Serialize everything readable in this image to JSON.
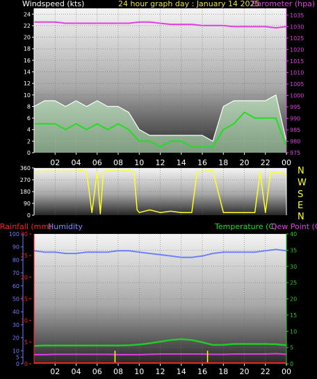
{
  "header": {
    "windspeed_title": "Windspeed (kts)",
    "graph_day": "24 hour graph day :  January 14 2025",
    "barometer_title": "Barometer (hpa)"
  },
  "mid_header": {
    "rainfall_title": "Rainfall (mm)",
    "humidity_title": "Humidity",
    "temperature_title": "Temperature (C)",
    "dewpoint_title": "Dew Point (C)"
  },
  "direction_labels": [
    "N",
    "W",
    "S",
    "E",
    "N"
  ],
  "colors": {
    "barometer": "#e040e0",
    "windspeed_gust": "#ffffff",
    "windspeed_avg": "#22dd22",
    "windspeed_fill": "#ccffcc",
    "direction": "#ffff22",
    "humidity": "#6f7fff",
    "temperature": "#22cc22",
    "dewpoint": "#e040e0",
    "rainfall": "#ff2020",
    "rain_event": "#ffff22"
  },
  "chart_data": [
    {
      "type": "line",
      "title": "Windspeed (kts) / Barometer (hpa)",
      "x_ticks": [
        "02",
        "04",
        "06",
        "08",
        "10",
        "12",
        "14",
        "16",
        "18",
        "20",
        "22",
        "00"
      ],
      "x_hours": [
        0,
        24
      ],
      "ylim_left": [
        0,
        25
      ],
      "y_ticks_left": [
        0,
        2,
        4,
        6,
        8,
        10,
        12,
        14,
        16,
        18,
        20,
        22,
        24
      ],
      "ylim_right": [
        975,
        1038
      ],
      "y_ticks_right": [
        975,
        980,
        985,
        990,
        995,
        1000,
        1005,
        1010,
        1015,
        1020,
        1025,
        1030,
        1035
      ],
      "series": [
        {
          "name": "Barometer",
          "axis": "right",
          "x": [
            0,
            1,
            2,
            3,
            4,
            5,
            6,
            7,
            8,
            9,
            10,
            11,
            12,
            13,
            14,
            15,
            16,
            17,
            18,
            19,
            20,
            21,
            22,
            23,
            24
          ],
          "values": [
            1032,
            1032,
            1032,
            1031.5,
            1031.5,
            1031.5,
            1031.5,
            1031.5,
            1031.5,
            1031.5,
            1032,
            1032,
            1031.5,
            1031,
            1031,
            1031,
            1030.5,
            1030.5,
            1030.5,
            1030,
            1030,
            1030,
            1030,
            1029.5,
            1030
          ]
        },
        {
          "name": "Gust",
          "axis": "left",
          "x": [
            0,
            1,
            2,
            3,
            4,
            5,
            6,
            7,
            8,
            9,
            10,
            11,
            12,
            13,
            14,
            15,
            16,
            17,
            18,
            19,
            20,
            21,
            22,
            23,
            24
          ],
          "values": [
            8,
            9,
            9,
            8,
            9,
            8,
            9,
            8,
            8,
            7,
            4,
            3,
            3,
            3,
            3,
            3,
            3,
            2,
            8,
            9,
            9,
            9,
            9,
            10,
            2
          ]
        },
        {
          "name": "Average",
          "axis": "left",
          "x": [
            0,
            1,
            2,
            3,
            4,
            5,
            6,
            7,
            8,
            9,
            10,
            11,
            12,
            13,
            14,
            15,
            16,
            17,
            18,
            19,
            20,
            21,
            22,
            23,
            24
          ],
          "values": [
            5,
            5,
            5,
            4,
            5,
            4,
            5,
            4,
            5,
            4,
            2,
            2,
            1,
            2,
            2,
            1,
            1,
            1,
            4,
            5,
            7,
            6,
            6,
            6,
            1
          ]
        }
      ]
    },
    {
      "type": "line",
      "title": "Wind direction",
      "x_hours": [
        0,
        24
      ],
      "ylim": [
        0,
        360
      ],
      "y_ticks": [
        0,
        90,
        180,
        270,
        360
      ],
      "series": [
        {
          "name": "Direction",
          "x": [
            0,
            1,
            2,
            3,
            4,
            4.5,
            5,
            5.5,
            6,
            6.3,
            6.6,
            7,
            8,
            9,
            9.5,
            9.8,
            10,
            11,
            12,
            13,
            14,
            15,
            15.5,
            16,
            17,
            18,
            19,
            20,
            21,
            21.5,
            22,
            22.5,
            23,
            24
          ],
          "values": [
            330,
            335,
            335,
            335,
            335,
            340,
            330,
            20,
            330,
            10,
            330,
            340,
            335,
            340,
            330,
            40,
            20,
            40,
            20,
            30,
            20,
            20,
            330,
            335,
            340,
            20,
            20,
            20,
            20,
            330,
            20,
            330,
            330,
            310
          ]
        }
      ]
    },
    {
      "type": "line",
      "title": "Rainfall / Humidity / Temperature / Dew Point",
      "x_ticks": [
        "02",
        "04",
        "06",
        "08",
        "10",
        "12",
        "14",
        "16",
        "18",
        "20",
        "22",
        "00"
      ],
      "x_hours": [
        0,
        24
      ],
      "ylim_humidity": [
        0,
        100
      ],
      "y_ticks_humidity": [
        0,
        5,
        10,
        20,
        30,
        40,
        50,
        60,
        70,
        80,
        90,
        100
      ],
      "ylim_rainfall": [
        0,
        30
      ],
      "y_ticks_rainfall": [
        0,
        5,
        10,
        15,
        20,
        25,
        30
      ],
      "ylim_temperature": [
        0,
        40
      ],
      "y_ticks_temperature": [
        0,
        5,
        10,
        15,
        20,
        25,
        30,
        35,
        40
      ],
      "series": [
        {
          "name": "Humidity",
          "axis": "humidity",
          "x": [
            0,
            1,
            2,
            3,
            4,
            5,
            6,
            7,
            8,
            9,
            10,
            11,
            12,
            13,
            14,
            15,
            16,
            17,
            18,
            19,
            20,
            21,
            22,
            23,
            24
          ],
          "values": [
            87,
            86,
            86,
            85,
            85,
            86,
            86,
            86,
            87,
            87,
            86,
            85,
            84,
            83,
            82,
            82,
            83,
            85,
            86,
            86,
            86,
            86,
            87,
            88,
            87
          ]
        },
        {
          "name": "Temperature",
          "axis": "temperature",
          "x": [
            0,
            1,
            2,
            3,
            4,
            5,
            6,
            7,
            8,
            9,
            10,
            11,
            12,
            13,
            14,
            15,
            16,
            17,
            18,
            19,
            20,
            21,
            22,
            23,
            24
          ],
          "values": [
            5.5,
            5.6,
            5.6,
            5.6,
            5.6,
            5.6,
            5.6,
            5.6,
            5.6,
            5.7,
            5.9,
            6.3,
            6.8,
            7.3,
            7.6,
            7.3,
            6.6,
            5.8,
            5.8,
            6.1,
            6.1,
            6.1,
            6.1,
            6,
            5.7
          ]
        },
        {
          "name": "Dew Point",
          "axis": "temperature",
          "x": [
            0,
            1,
            2,
            3,
            4,
            5,
            6,
            7,
            8,
            9,
            10,
            11,
            12,
            13,
            14,
            15,
            16,
            17,
            18,
            19,
            20,
            21,
            22,
            23,
            24
          ],
          "values": [
            2.8,
            2.8,
            2.9,
            2.9,
            2.9,
            2.9,
            2.9,
            2.9,
            2.8,
            2.8,
            2.8,
            2.9,
            3,
            3,
            3,
            3,
            3,
            2.9,
            2.9,
            3,
            3,
            3,
            3,
            3.1,
            2.9
          ]
        },
        {
          "name": "Rain events",
          "axis": "rainfall",
          "x": [
            7.7,
            16.5
          ],
          "values": [
            3,
            3
          ]
        }
      ]
    }
  ]
}
